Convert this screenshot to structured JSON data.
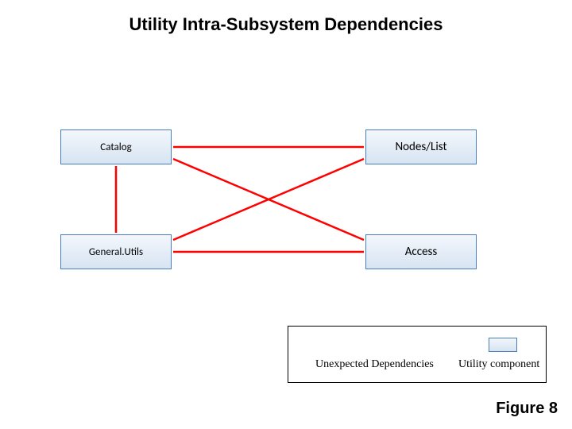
{
  "title": "Utility Intra-Subsystem Dependencies",
  "nodes": {
    "catalog": "Catalog",
    "nodeslist": "Nodes/List",
    "generalutils": "General.Utils",
    "access": "Access"
  },
  "legend": {
    "unexpected": "Unexpected Dependencies",
    "component": "Utility component"
  },
  "figure_label": "Figure 8",
  "colors": {
    "arrow": "#ff0000",
    "node_border": "#4a7dbd"
  },
  "chart_data": {
    "type": "diagram",
    "title": "Utility Intra-Subsystem Dependencies",
    "nodes": [
      "Catalog",
      "Nodes/List",
      "General.Utils",
      "Access"
    ],
    "edges": [
      {
        "from": "Catalog",
        "to": "Nodes/List",
        "bidirectional": true,
        "kind": "unexpected"
      },
      {
        "from": "Catalog",
        "to": "General.Utils",
        "bidirectional": true,
        "kind": "unexpected"
      },
      {
        "from": "Catalog",
        "to": "Access",
        "bidirectional": true,
        "kind": "unexpected"
      },
      {
        "from": "General.Utils",
        "to": "Nodes/List",
        "bidirectional": true,
        "kind": "unexpected"
      },
      {
        "from": "General.Utils",
        "to": "Access",
        "bidirectional": true,
        "kind": "unexpected"
      }
    ],
    "legend": [
      {
        "label": "Unexpected Dependencies",
        "symbol": "red-double-arrow"
      },
      {
        "label": "Utility component",
        "symbol": "blue-box"
      }
    ],
    "figure": "Figure 8"
  }
}
